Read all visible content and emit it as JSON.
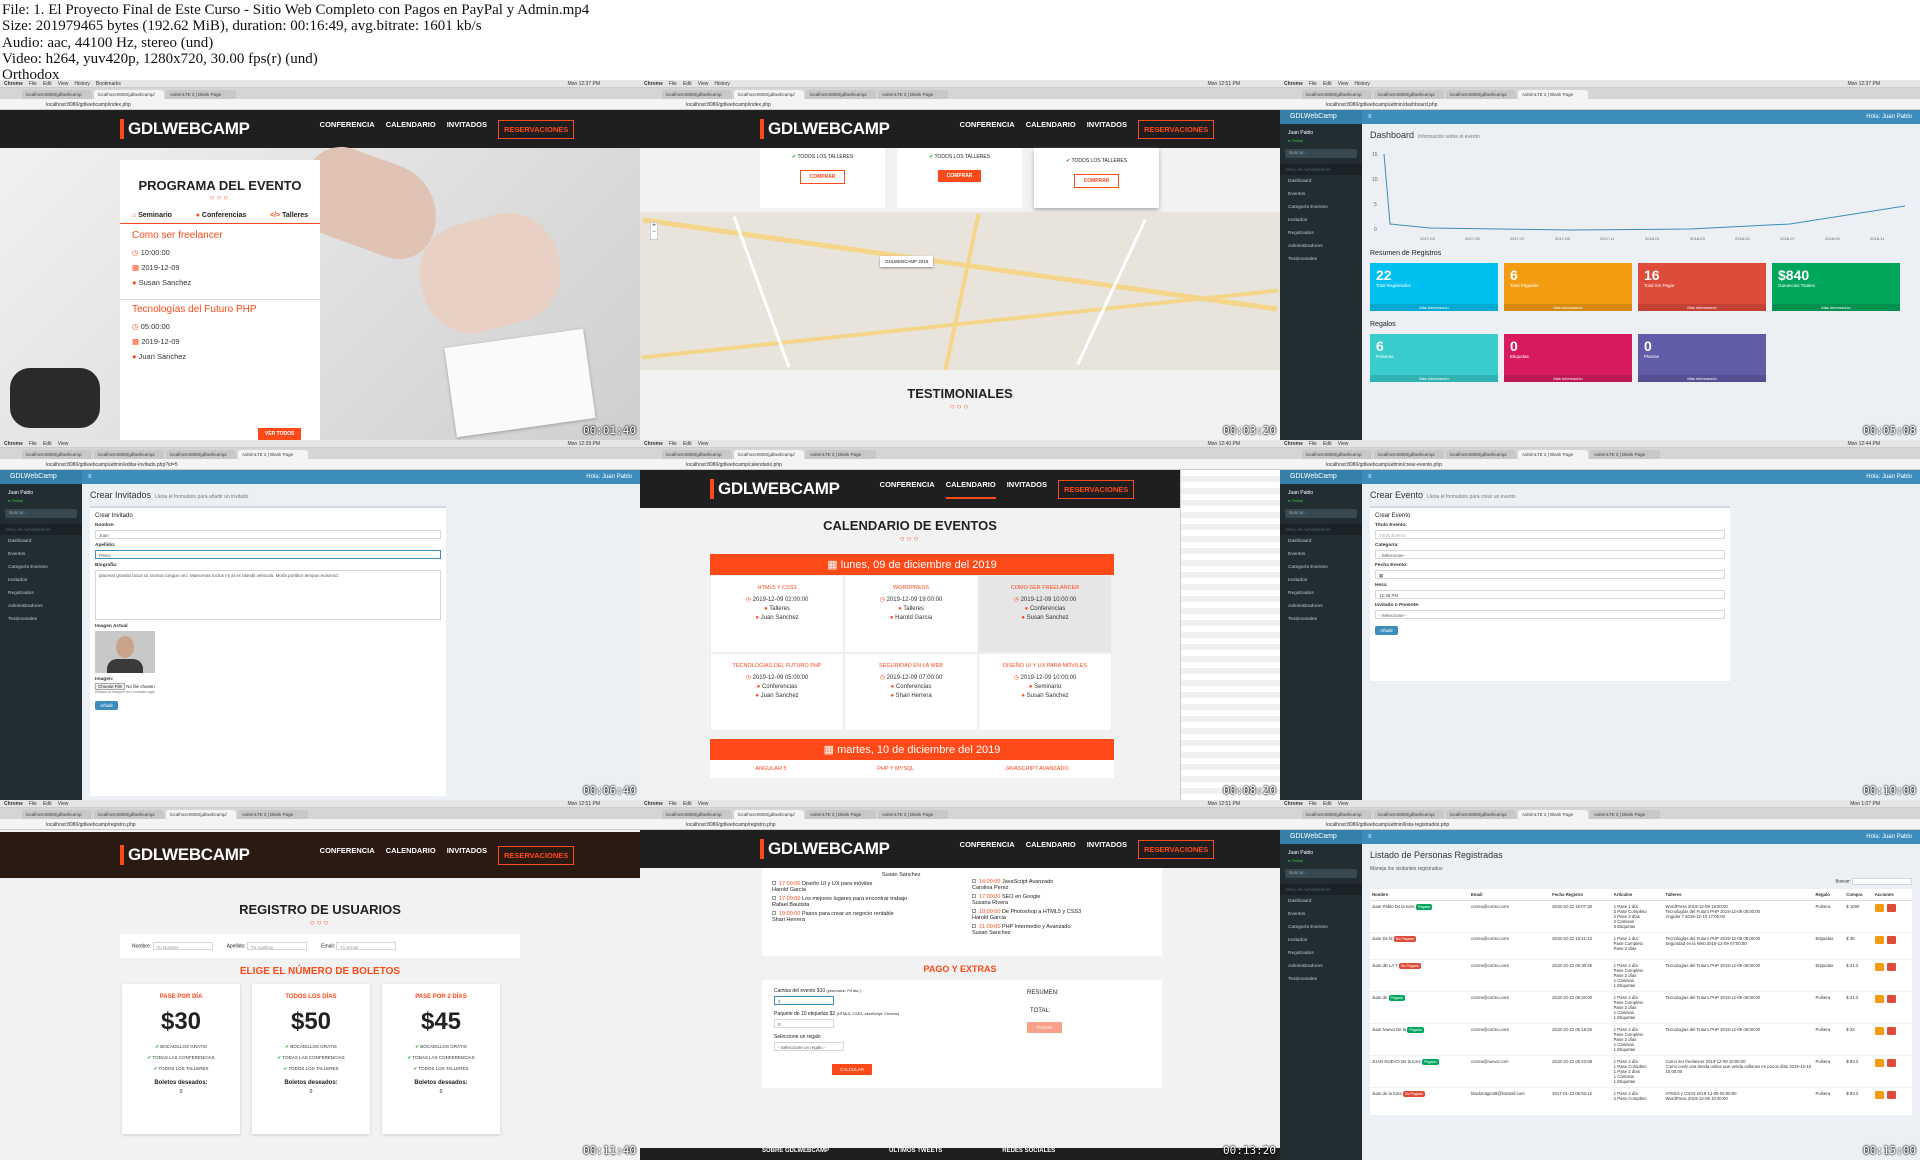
{
  "header": {
    "lines": [
      "File: 1. El Proyecto Final de Este Curso - Sitio Web Completo con Pagos en PayPal y Admin.mp4",
      "Size: 201979465 bytes (192.62 MiB), duration: 00:16:49, avg.bitrate: 1601 kb/s",
      "Audio: aac, 44100 Hz, stereo (und)",
      "Video: h264, yuv420p, 1280x720, 30.00 fps(r) (und)",
      "Orthodox"
    ]
  },
  "common": {
    "mac_menu": [
      "Chrome",
      "File",
      "Edit",
      "View",
      "History",
      "Bookmarks",
      "People",
      "Window",
      "Help"
    ],
    "site_logo": "GDLWEBCAMP",
    "site_nav": [
      "CONFERENCIA",
      "CALENDARIO",
      "INVITADOS",
      "RESERVACIONES"
    ],
    "admin_brand": "GDLWebCamp",
    "admin_user": "Juan Pablo",
    "admin_hello": "Hola: Juan Pablo",
    "admin_online": "● Online",
    "admin_search": "Buscar...",
    "admin_menu_header": "Menú de Administración",
    "admin_menu": [
      "Dashboard",
      "Eventos",
      "Categoría Eventos",
      "Invitados",
      "Registrados",
      "Administradores",
      "Testimoniales"
    ]
  },
  "frames": [
    {
      "timestamp": "00:01:40",
      "tabs": [
        "localhost:8080/gdlwebcamp",
        "localhost:8080/gdlwebcamp/",
        "AdminLTE 2 | Blank Page"
      ],
      "url": "localhost:8080/gdlwebcamp/index.php",
      "clock": "Mon 12:37 PM",
      "section_title": "PROGRAMA DEL EVENTO",
      "event_tabs": [
        "Seminario",
        "Conferencias",
        "Talleres"
      ],
      "events": [
        {
          "title": "Como ser freelancer",
          "time": "10:00:00",
          "date": "2019-12-09",
          "speaker": "Susan Sanchez"
        },
        {
          "title": "Tecnologías del Futuro PHP",
          "time": "05:00:00",
          "date": "2019-12-09",
          "speaker": "Juan Sanchez"
        }
      ],
      "button": "VER TODOS"
    },
    {
      "timestamp": "00:03:20",
      "tabs": [
        "localhost:8080/gdlwebcamp",
        "localhost:8080/gdlwebcamp/",
        "localhost:8080/gdlwebcamp/",
        "AdminLTE 2 | Blank Page"
      ],
      "url": "localhost:8080/gdlwebcamp/index.php",
      "clock": "Mon 12:51 PM",
      "pricing_item": "TODOS LOS TALLERES",
      "buy_button": "COMPRAR",
      "map_marker": "GDLWEBCAMP 2019",
      "section_title": "TESTIMONIALES"
    },
    {
      "timestamp": "00:05:08",
      "tabs": [
        "localhost:8080/gdlwebcamp",
        "localhost:8080/gdlwebcamp/",
        "localhost:8080/gdlwebcamp/",
        "AdminLTE 2 | Blank Page"
      ],
      "url": "localhost:8080/gdlwebcamp/admin/dashboard.php",
      "clock": "Mon 12:37 PM",
      "title": "Dashboard",
      "subtitle": "Información sobre el evento",
      "chart_y_ticks": [
        "15",
        "10",
        "5",
        "0"
      ],
      "chart_x_ticks": [
        "2017-03",
        "2017-05",
        "2017-07",
        "2017-08",
        "2017-11",
        "2018-01",
        "2018-03",
        "2018-05",
        "2018-07",
        "2018-09",
        "2018-11"
      ],
      "resumen_title": "Resumen de Registros",
      "resumen": [
        {
          "value": "22",
          "label": "Total Registrados",
          "color": "#00c0ef"
        },
        {
          "value": "6",
          "label": "Total Pagados",
          "color": "#f39c12"
        },
        {
          "value": "16",
          "label": "Total Sin Pagar",
          "color": "#dd4b39"
        },
        {
          "value": "$840",
          "label": "Ganancias Totales",
          "color": "#00a65a"
        }
      ],
      "regalos_title": "Regalos",
      "regalos": [
        {
          "value": "6",
          "label": "Pulseras",
          "color": "#39cccc"
        },
        {
          "value": "0",
          "label": "Etiquetas",
          "color": "#d81b60"
        },
        {
          "value": "0",
          "label": "Plumas",
          "color": "#605ca8"
        }
      ],
      "more_info": "Más información"
    },
    {
      "timestamp": "00:06:40",
      "tabs": [
        "localhost:8080/gdlwebcamp",
        "localhost:8080/gdlwebcamp/",
        "localhost:8080/gdlwebcamp/",
        "AdminLTE 2 | Blank Page"
      ],
      "url": "localhost:8080/gdlwebcamp/admin/editar-invitado.php?id=5",
      "clock": "Mon 12:39 PM",
      "title": "Crear Invitados",
      "subtitle": "Llena el formulario para añadir un invitado",
      "box_title": "Crear Invitado",
      "fields": [
        {
          "label": "Nombre:",
          "value": "Juan"
        },
        {
          "label": "Apellido:",
          "value": "Perez"
        }
      ],
      "bio_label": "Biografía:",
      "bio_text": "placerat gravida lacus ut, lacinia congue orci. Maecenas luctus mi at ex blandit vehicula. Morbi porttitor tempus euismod.",
      "image_label": "Imagen Actual",
      "upload_label": "Imagen:",
      "upload_button": "Choose File",
      "upload_status": "No file chosen",
      "upload_help": "Añada la imagen del invitado aquí",
      "submit": "Añadir"
    },
    {
      "timestamp": "00:08:20",
      "tabs": [
        "localhost:8080/gdlwebcamp",
        "localhost:8080/gdlwebcamp/",
        "AdminLTE 2 | Blank Page"
      ],
      "url": "localhost:8080/gdlwebcamp/calendario.php",
      "clock": "Mon 12:40 PM",
      "section_title": "CALENDARIO DE EVENTOS",
      "day1": "lunes, 09 de diciembre del 2019",
      "day1_events": [
        {
          "title": "HTML5 Y CSS3",
          "datetime": "2019-12-09 02:00:00",
          "category": "Talleres",
          "speaker": "Juan Sanchez"
        },
        {
          "title": "WORDPRESS",
          "datetime": "2019-12-09 19:00:00",
          "category": "Talleres",
          "speaker": "Harold Garcia"
        },
        {
          "title": "COMO SER FREELANCER",
          "datetime": "2019-12-09 10:00:00",
          "category": "Conferencias",
          "speaker": "Susan Sanchez"
        },
        {
          "title": "TECNOLOGÍAS DEL FUTURO PHP",
          "datetime": "2019-12-09 05:00:00",
          "category": "Conferencias",
          "speaker": "Juan Sanchez"
        },
        {
          "title": "SEGURIDAD EN LA WEB",
          "datetime": "2019-12-09 07:00:00",
          "category": "Conferencias",
          "speaker": "Shari Herrera"
        },
        {
          "title": "DISEÑO UI Y UX PARA MÓVILES",
          "datetime": "2019-12-09 10:00:00",
          "category": "Seminario",
          "speaker": "Susan Sanchez"
        }
      ],
      "day2": "martes, 10 de diciembre del 2019",
      "day2_events": [
        "ANGULAR 5",
        "PHP Y MYSQL",
        "JAVASCRIPT AVANZADO"
      ]
    },
    {
      "timestamp": "00:10:00",
      "tabs": [
        "localhost:8080/gdlwebcamp",
        "localhost:8080/gdlwebcamp/",
        "localhost:8080/gdlwebcamp/",
        "AdminLTE 2 | Blank Page",
        "AdminLTE 2 | Blank Page"
      ],
      "url": "localhost:8080/gdlwebcamp/admin/crear-evento.php",
      "clock": "Mon 12:44 PM",
      "title": "Crear Evento",
      "subtitle": "Llena el formulario para crear un evento",
      "box_title": "Crear Evento",
      "fields": [
        {
          "label": "Título Evento:",
          "value": "Título Evento"
        },
        {
          "label": "Categoría:",
          "value": "- Seleccione -"
        },
        {
          "label": "Fecha Evento:",
          "value": ""
        },
        {
          "label": "Hora:",
          "value": "12:38 PM"
        },
        {
          "label": "Invitado o Ponente:",
          "value": "- Seleccione -"
        }
      ],
      "submit": "Añadir"
    },
    {
      "timestamp": "00:11:40",
      "tabs": [
        "localhost:8080/gdlwebcamp",
        "localhost:8080/gdlwebcamp/",
        "localhost:8080/gdlwebcamp/",
        "AdminLTE 2 | Blank Page"
      ],
      "url": "localhost:8080/gdlwebcamp/registro.php",
      "clock": "Mon 12:51 PM",
      "section_title": "REGISTRO DE USUARIOS",
      "form_fields": [
        {
          "label": "Nombre:",
          "placeholder": "Tu Nombre"
        },
        {
          "label": "Apellido:",
          "placeholder": "Tu Apellido"
        },
        {
          "label": "Email:",
          "placeholder": "Tu Email"
        }
      ],
      "tickets_title": "ELIGE EL NÚMERO DE BOLETOS",
      "plans": [
        {
          "name": "PASE POR DÍA",
          "price": "$30",
          "items": [
            "BOCADILLOS GRATIS",
            "TODAS LAS CONFERENCIAS",
            "TODOS LOS TALLERES"
          ]
        },
        {
          "name": "TODOS LOS DÍAS",
          "price": "$50",
          "items": [
            "BOCADILLOS GRATIS",
            "TODAS LAS CONFERENCIAS",
            "TODOS LOS TALLERES"
          ]
        },
        {
          "name": "PASE POR 2 DÍAS",
          "price": "$45",
          "items": [
            "BOCADILLOS GRATIS",
            "TODAS LAS CONFERENCIAS",
            "TODOS LOS TALLERES"
          ]
        }
      ],
      "boletos_label": "Boletos deseados:",
      "boletos_value": "0"
    },
    {
      "timestamp": "00:13:20",
      "tabs": [
        "localhost:8080/gdlwebcamp",
        "localhost:8080/gdlwebcamp/",
        "AdminLTE 2 | Blank Page",
        "AdminLTE 2 | Blank Page"
      ],
      "url": "localhost:8080/gdlwebcamp/registro.php",
      "clock": "Mon 12:51 PM",
      "left_events": [
        {
          "time": "17:00:00",
          "text": "Diseño UI y UX para móviles",
          "speaker": "Harold Garcia"
        },
        {
          "time": "17:00:00",
          "text": "Los mejores lugares para encontrar trabajo",
          "speaker": "Rafael Bautista"
        },
        {
          "time": "19:00:00",
          "text": "Pasos para crear un negocio rentable",
          "speaker": "Shari Herrera"
        }
      ],
      "left_top_speaker": "Susan Sanchez",
      "right_events": [
        {
          "time": "14:00:00",
          "text": "JavaScript Avanzado",
          "speaker": "Carolina Perez"
        },
        {
          "time": "17:00:00",
          "text": "SEO en Google",
          "speaker": "Susana Rivera"
        },
        {
          "time": "19:00:00",
          "text": "De Photoshop a HTML5 y CSS3",
          "speaker": "Harold Garcia"
        },
        {
          "time": "21:00:00",
          "text": "PHP Intermedio y Avanzado",
          "speaker": "Susan Sanchez"
        }
      ],
      "pago_title": "PAGO Y EXTRAS",
      "camisa_label": "Camisa del evento $10",
      "camisa_promo": "(promocion 7% dto.)",
      "camisa_value": "2",
      "etiquetas_label": "Paquete de 10 etiquetas $2",
      "etiquetas_note": "(HTML5, CSS3, JavaScript, Chrome)",
      "etiquetas_value": "0",
      "regalo_label": "Seleccione un regalo",
      "regalo_value": "- Seleccione un regalo -",
      "calcular": "CALCULAR",
      "resumen": "RESUMEN:",
      "total": "TOTAL:",
      "pagar": "PAGAR",
      "footer": [
        "SOBRE GDLWEBCAMP",
        "ÚLTIMOS TWEETS",
        "REDES SOCIALES"
      ]
    },
    {
      "timestamp": "00:15:00",
      "tabs": [
        "localhost:8080/gdlwebcamp",
        "localhost:8080/gdlwebcamp/",
        "localhost:8080/gdlwebcamp/",
        "AdminLTE 2 | Blank Page",
        "AdminLTE 2 | Blank Page"
      ],
      "url": "localhost:8080/gdlwebcamp/admin/lista-registrados.php",
      "clock": "Mon 1:07 PM",
      "title": "Listado de Personas Registradas",
      "subtitle": "Maneja los visitantes registrados",
      "search_label": "Buscar:",
      "columns": [
        "Nombre",
        "Email",
        "Fecha Registro",
        "Artículos",
        "Talleres",
        "Regalo",
        "Compra",
        "Acciones"
      ],
      "rows": [
        {
          "name": "Juan Pablo De la torre",
          "status": "Pagado",
          "email": "correo@correo.com",
          "date": "2018-10-22 16:07:30",
          "items": "1 Pase 1 día\n3 Pase Completo\n2 Pase 2 días\n2 Camisas\n3 Etiquetas",
          "talleres": "WordPress 2019-12-09 19:00:00\nTecnologías del Futuro PHP 2019-12-09 05:00:00\nAngular 7 2019-12-10 17:00:00",
          "regalo": "Pulsera",
          "compra": "$ 1000"
        },
        {
          "name": "Juan De la",
          "status": "No Pagado",
          "email": "correo@correo.com",
          "date": "2018-10-22 16:41:13",
          "items": "1 Pase 1 día\nPase Completo\nPase 2 días",
          "talleres": "Tecnologías del Futuro PHP 2019-12-09 05:00:00\nSeguridad en la Web 2019-12-09 07:00:00",
          "regalo": "Etiquetas",
          "compra": "$ 36"
        },
        {
          "name": "Juan dE LA T",
          "status": "No Pagado",
          "email": "correo@correo.com",
          "date": "2018-10-22 06:30:45",
          "items": "1 Pase 1 día\nPase Completo\nPase 2 días\n1 Camisas\n1 Etiquetas",
          "talleres": "Tecnologías del Futuro PHP 2019-12-09 05:00:00",
          "regalo": "Etiquetas",
          "compra": "$ 41.3"
        },
        {
          "name": "Juan de",
          "status": "Pagado",
          "email": "correo@correo.com",
          "date": "2018-10-22 06:20:00",
          "items": "1 Pase 1 día\nPase Completo\nPase 2 días\n1 Camisas\n1 Etiquetas",
          "talleres": "Tecnologías del Futuro PHP 2019-12-09 05:00:00",
          "regalo": "Pulsera",
          "compra": "$ 41.3"
        },
        {
          "name": "Juan Nuevo De la",
          "status": "Pagado",
          "email": "correo@correo.com",
          "date": "2018-10-22 06:18:26",
          "items": "1 Pase 1 día\nPase Completo\nPase 2 días\n1 Camisas\n1 Etiquetas",
          "talleres": "Tecnologías del Futuro PHP 2019-12-09 05:00:00",
          "regalo": "Pulsera",
          "compra": "$ 32"
        },
        {
          "name": "JUAN NUEVO De la torre",
          "status": "Pagado",
          "email": "correo@nuevo.com",
          "date": "2018-10-22 06:43:08",
          "items": "1 Pase 1 día\n1 Pase Completo\n1 Pase 2 días\n1 Camisas\n1 Etiquetas",
          "talleres": "Como ser freelancer 2019-12-09 10:00:00\nComo crear una tienda online que venda millones en pocos días 2019-12-10 10:00:00",
          "regalo": "Pulsera",
          "compra": "$ 93.3"
        },
        {
          "name": "Juan de la torre",
          "status": "No Pagado",
          "email": "blackmagic58@hotmail.com",
          "date": "2017-01-13 06:53:12",
          "items": "1 Pase 1 día\n2 Pase Completo",
          "talleres": "HTML5 y CSS3 2019-12-09 02:00:00\nWordPress 2019-12-09 10:00:00",
          "regalo": "Pulsera",
          "compra": "$ 93.3"
        }
      ]
    }
  ]
}
